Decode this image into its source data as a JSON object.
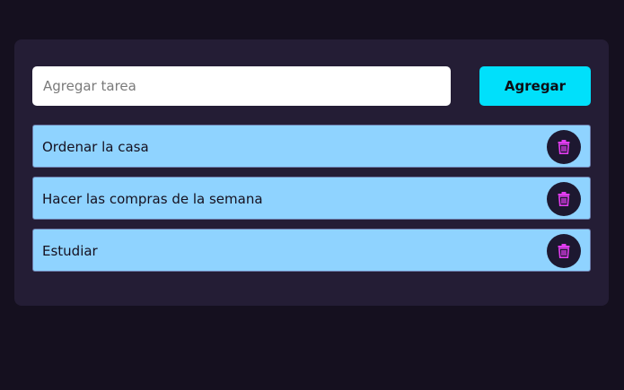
{
  "form": {
    "placeholder": "Agregar tarea",
    "value": "",
    "add_label": "Agregar"
  },
  "tasks": [
    {
      "label": "Ordenar la casa",
      "icon": "trash-icon"
    },
    {
      "label": "Hacer las compras de la semana",
      "icon": "trash-icon"
    },
    {
      "label": "Estudiar",
      "icon": "trash-icon"
    }
  ],
  "colors": {
    "background": "#15101f",
    "panel": "#241d35",
    "accent": "#00e0fb",
    "task_bg": "#8fd3ff",
    "delete_icon": "#e23df0"
  }
}
